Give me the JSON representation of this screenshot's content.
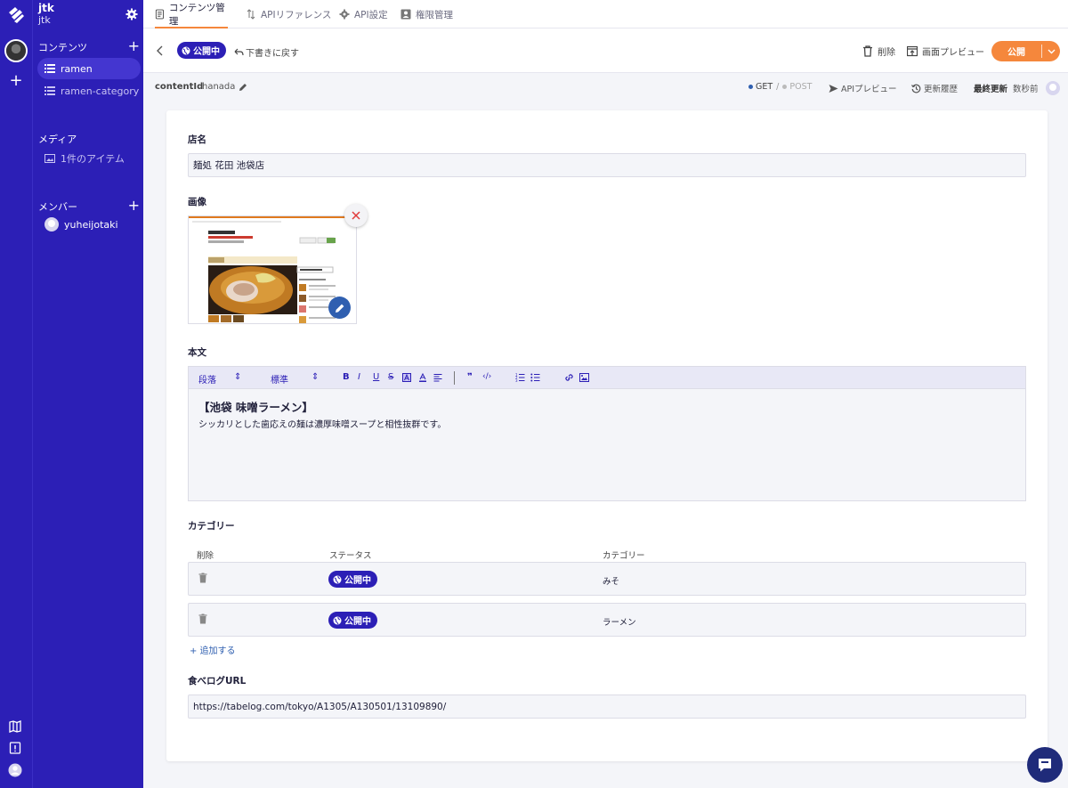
{
  "workspace": {
    "name": "jtk",
    "id": "jtk"
  },
  "sidebar": {
    "contents_title": "コンテンツ",
    "contents": [
      {
        "label": "ramen",
        "active": true
      },
      {
        "label": "ramen-category",
        "active": false
      }
    ],
    "media_title": "メディア",
    "media_item": "1件のアイテム",
    "members_title": "メンバー",
    "members": [
      {
        "label": "yuheijotaki"
      }
    ]
  },
  "tabs": [
    {
      "label": "コンテンツ管理",
      "icon": "document-icon",
      "active": true
    },
    {
      "label": "APIリファレンス",
      "icon": "arrows-icon",
      "active": false
    },
    {
      "label": "API設定",
      "icon": "gear-icon",
      "active": false
    },
    {
      "label": "権限管理",
      "icon": "user-card-icon",
      "active": false
    }
  ],
  "actionbar": {
    "status": "公開中",
    "revert": "下書きに戻す",
    "delete": "削除",
    "preview": "画面プレビュー",
    "publish": "公開"
  },
  "meta": {
    "content_id_label": "contentId",
    "content_id": "hanada",
    "get": "GET",
    "separator": "/",
    "post": "POST",
    "api_preview": "APIプレビュー",
    "history": "更新履歴",
    "last_updated_label": "最終更新",
    "last_updated": "数秒前"
  },
  "form": {
    "name_label": "店名",
    "name_value": "麺処 花田 池袋店",
    "image_label": "画像",
    "body_label": "本文",
    "toolbar": {
      "paragraph": "段落",
      "size": "標準",
      "bold": "B",
      "italic": "I",
      "underline": "U",
      "strike": "S"
    },
    "body_heading": "【池袋 味噌ラーメン】",
    "body_text": "シッカリとした歯応えの麺は濃厚味噌スープと相性抜群です。",
    "category_label": "カテゴリー",
    "category_columns": [
      "削除",
      "ステータス",
      "カテゴリー"
    ],
    "categories": [
      {
        "status": "公開中",
        "name": "みそ"
      },
      {
        "status": "公開中",
        "name": "ラーメン"
      }
    ],
    "add_more": "+ 追加する",
    "url_label": "食べログURL",
    "url_value": "https://tabelog.com/tokyo/A1305/A130501/13109890/"
  },
  "colors": {
    "brand": "#2c1fb6",
    "accent": "#f5873c",
    "link": "#2f5fb0"
  }
}
